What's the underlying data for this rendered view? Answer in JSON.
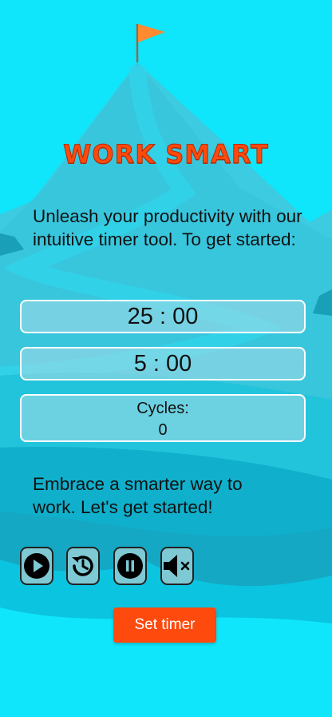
{
  "header": {
    "title": "WORK SMART"
  },
  "intro": {
    "text": "Unleash your productivity with our intuitive timer tool. To get started:"
  },
  "timers": {
    "work": "25 : 00",
    "rest": "5 : 00",
    "cycles_label": "Cycles:",
    "cycles_value": "0"
  },
  "outro": {
    "text": "Embrace a smarter way to work. Let's get started!"
  },
  "controls": {
    "play_icon": "play-icon",
    "reset_icon": "history-icon",
    "pause_icon": "pause-icon",
    "mute_icon": "volume-mute-icon"
  },
  "actions": {
    "set_timer_label": "Set timer"
  },
  "colors": {
    "background": "#0fe6fb",
    "accent": "#ff4a0d",
    "mountain": "#33cde0",
    "slope": "#1fb8d0"
  }
}
